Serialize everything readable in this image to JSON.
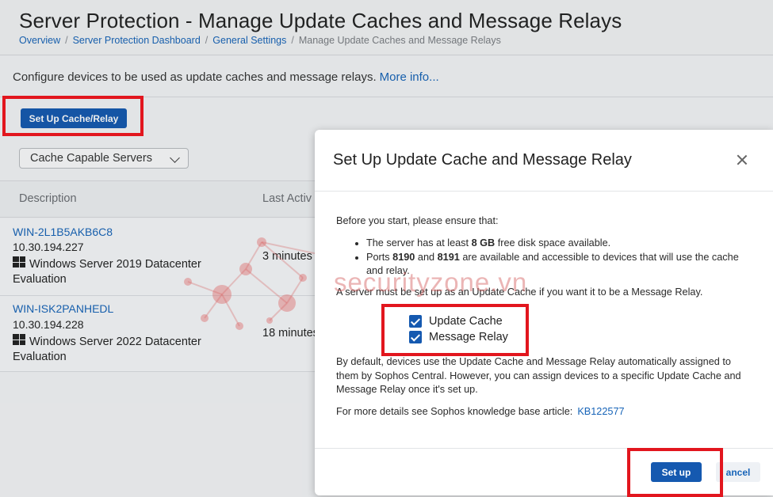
{
  "header": {
    "title": "Server Protection - Manage Update Caches and Message Relays",
    "breadcrumbs": [
      "Overview",
      "Server Protection Dashboard",
      "General Settings"
    ],
    "breadcrumb_current": "Manage Update Caches and Message Relays",
    "separator": "/"
  },
  "intro": {
    "text": "Configure devices to be used as update caches and message relays.",
    "link": "More info..."
  },
  "toolbar": {
    "setup_button": "Set Up Cache/Relay",
    "filter_value": "Cache Capable Servers"
  },
  "table": {
    "columns": [
      "Description",
      "Last Activ"
    ],
    "rows": [
      {
        "name": "WIN-2L1B5AKB6C8",
        "ip": "10.30.194.227",
        "os": "Windows Server 2019 Datacenter Evaluation",
        "last_activity": "3 minutes"
      },
      {
        "name": "WIN-ISK2PANHEDL",
        "ip": "10.30.194.228",
        "os": "Windows Server 2022 Datacenter Evaluation",
        "last_activity": "18 minutes"
      }
    ]
  },
  "watermark": "securityzone.vn",
  "modal": {
    "title": "Set Up Update Cache and Message Relay",
    "intro": "Before you start, please ensure that:",
    "bullet1": {
      "pre": "The server has at least ",
      "bold": "8 GB",
      "post": " free disk space available."
    },
    "bullet2": {
      "pre": "Ports ",
      "bold1": "8190",
      "mid": " and ",
      "bold2": "8191",
      "post": " are available and accessible to devices that will use the cache and relay."
    },
    "requirement": "A server must be set up as an Update Cache if you want it to be a Message Relay.",
    "checkboxes": [
      {
        "label": "Update Cache",
        "checked": true
      },
      {
        "label": "Message Relay",
        "checked": true
      }
    ],
    "default_text": "By default, devices use the Update Cache and Message Relay automatically assigned to them by Sophos Central. However, you can assign devices to a specific Update Cache and Message Relay once it's set up.",
    "kb_text": "For more details see Sophos knowledge base article:",
    "kb_link": "KB122577",
    "primary_button": "Set up",
    "cancel_button": "ancel"
  },
  "colors": {
    "primary": "#1559b0",
    "link": "#1764b8",
    "highlight": "#e2161e"
  }
}
